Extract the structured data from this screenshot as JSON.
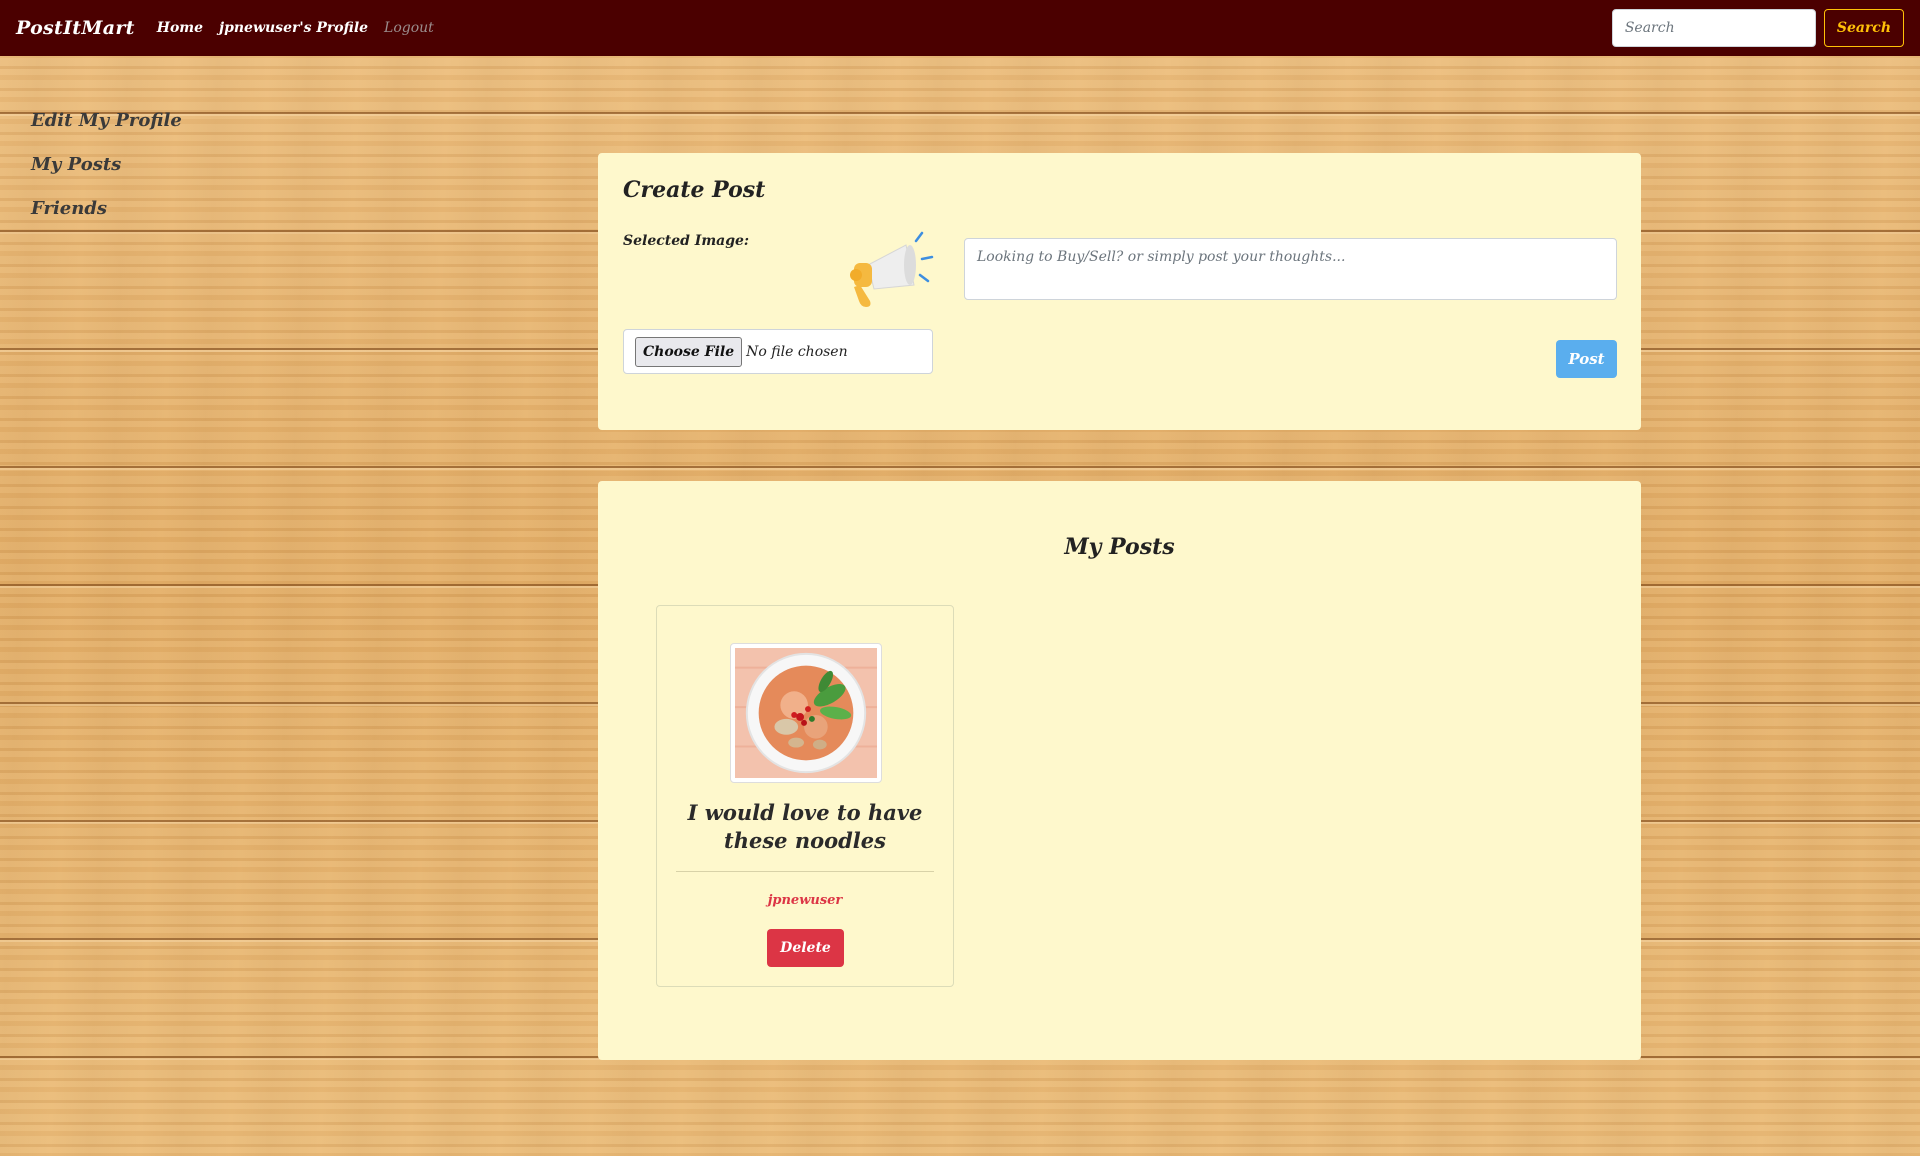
{
  "nav": {
    "brand": "PostItMart",
    "links": [
      "Home",
      "jpnewuser's Profile",
      "Logout"
    ],
    "search_placeholder": "Search",
    "search_button": "Search"
  },
  "sidebar": {
    "items": [
      "Edit My Profile",
      "My Posts",
      "Friends"
    ]
  },
  "create_post": {
    "title": "Create Post",
    "selected_image_label": "Selected Image:",
    "textarea_placeholder": "Looking to Buy/Sell? or simply post your thoughts...",
    "choose_file_label": "Choose File",
    "no_file_text": "No file chosen",
    "post_button": "Post"
  },
  "my_posts": {
    "title": "My Posts",
    "posts": [
      {
        "text": "I would love to have these noodles",
        "author": "jpnewuser",
        "delete_button": "Delete"
      }
    ]
  },
  "colors": {
    "navbar": "#4b0000",
    "panel": "#fef8cc",
    "search_accent": "#ffc107",
    "post_button": "#5aaeee",
    "danger": "#dc3545"
  },
  "icons": {
    "create_post_image": "megaphone-icon",
    "post_image": "noodle-bowl-photo"
  }
}
